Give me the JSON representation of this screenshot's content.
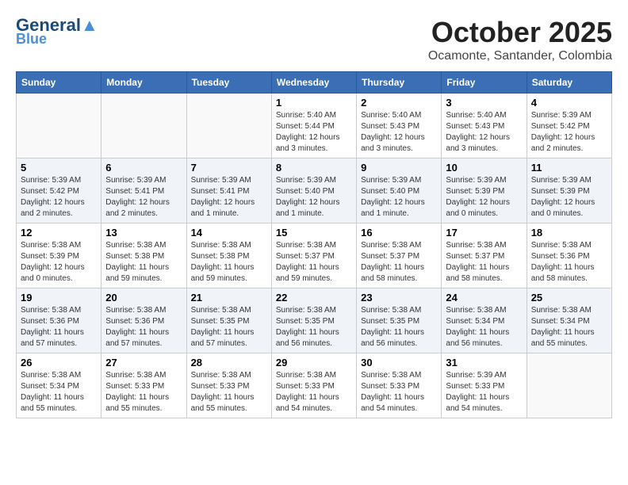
{
  "header": {
    "logo_line1": "General",
    "logo_line2": "Blue",
    "month": "October 2025",
    "location": "Ocamonte, Santander, Colombia"
  },
  "weekdays": [
    "Sunday",
    "Monday",
    "Tuesday",
    "Wednesday",
    "Thursday",
    "Friday",
    "Saturday"
  ],
  "weeks": [
    [
      {
        "day": "",
        "info": ""
      },
      {
        "day": "",
        "info": ""
      },
      {
        "day": "",
        "info": ""
      },
      {
        "day": "1",
        "info": "Sunrise: 5:40 AM\nSunset: 5:44 PM\nDaylight: 12 hours\nand 3 minutes."
      },
      {
        "day": "2",
        "info": "Sunrise: 5:40 AM\nSunset: 5:43 PM\nDaylight: 12 hours\nand 3 minutes."
      },
      {
        "day": "3",
        "info": "Sunrise: 5:40 AM\nSunset: 5:43 PM\nDaylight: 12 hours\nand 3 minutes."
      },
      {
        "day": "4",
        "info": "Sunrise: 5:39 AM\nSunset: 5:42 PM\nDaylight: 12 hours\nand 2 minutes."
      }
    ],
    [
      {
        "day": "5",
        "info": "Sunrise: 5:39 AM\nSunset: 5:42 PM\nDaylight: 12 hours\nand 2 minutes."
      },
      {
        "day": "6",
        "info": "Sunrise: 5:39 AM\nSunset: 5:41 PM\nDaylight: 12 hours\nand 2 minutes."
      },
      {
        "day": "7",
        "info": "Sunrise: 5:39 AM\nSunset: 5:41 PM\nDaylight: 12 hours\nand 1 minute."
      },
      {
        "day": "8",
        "info": "Sunrise: 5:39 AM\nSunset: 5:40 PM\nDaylight: 12 hours\nand 1 minute."
      },
      {
        "day": "9",
        "info": "Sunrise: 5:39 AM\nSunset: 5:40 PM\nDaylight: 12 hours\nand 1 minute."
      },
      {
        "day": "10",
        "info": "Sunrise: 5:39 AM\nSunset: 5:39 PM\nDaylight: 12 hours\nand 0 minutes."
      },
      {
        "day": "11",
        "info": "Sunrise: 5:39 AM\nSunset: 5:39 PM\nDaylight: 12 hours\nand 0 minutes."
      }
    ],
    [
      {
        "day": "12",
        "info": "Sunrise: 5:38 AM\nSunset: 5:39 PM\nDaylight: 12 hours\nand 0 minutes."
      },
      {
        "day": "13",
        "info": "Sunrise: 5:38 AM\nSunset: 5:38 PM\nDaylight: 11 hours\nand 59 minutes."
      },
      {
        "day": "14",
        "info": "Sunrise: 5:38 AM\nSunset: 5:38 PM\nDaylight: 11 hours\nand 59 minutes."
      },
      {
        "day": "15",
        "info": "Sunrise: 5:38 AM\nSunset: 5:37 PM\nDaylight: 11 hours\nand 59 minutes."
      },
      {
        "day": "16",
        "info": "Sunrise: 5:38 AM\nSunset: 5:37 PM\nDaylight: 11 hours\nand 58 minutes."
      },
      {
        "day": "17",
        "info": "Sunrise: 5:38 AM\nSunset: 5:37 PM\nDaylight: 11 hours\nand 58 minutes."
      },
      {
        "day": "18",
        "info": "Sunrise: 5:38 AM\nSunset: 5:36 PM\nDaylight: 11 hours\nand 58 minutes."
      }
    ],
    [
      {
        "day": "19",
        "info": "Sunrise: 5:38 AM\nSunset: 5:36 PM\nDaylight: 11 hours\nand 57 minutes."
      },
      {
        "day": "20",
        "info": "Sunrise: 5:38 AM\nSunset: 5:36 PM\nDaylight: 11 hours\nand 57 minutes."
      },
      {
        "day": "21",
        "info": "Sunrise: 5:38 AM\nSunset: 5:35 PM\nDaylight: 11 hours\nand 57 minutes."
      },
      {
        "day": "22",
        "info": "Sunrise: 5:38 AM\nSunset: 5:35 PM\nDaylight: 11 hours\nand 56 minutes."
      },
      {
        "day": "23",
        "info": "Sunrise: 5:38 AM\nSunset: 5:35 PM\nDaylight: 11 hours\nand 56 minutes."
      },
      {
        "day": "24",
        "info": "Sunrise: 5:38 AM\nSunset: 5:34 PM\nDaylight: 11 hours\nand 56 minutes."
      },
      {
        "day": "25",
        "info": "Sunrise: 5:38 AM\nSunset: 5:34 PM\nDaylight: 11 hours\nand 55 minutes."
      }
    ],
    [
      {
        "day": "26",
        "info": "Sunrise: 5:38 AM\nSunset: 5:34 PM\nDaylight: 11 hours\nand 55 minutes."
      },
      {
        "day": "27",
        "info": "Sunrise: 5:38 AM\nSunset: 5:33 PM\nDaylight: 11 hours\nand 55 minutes."
      },
      {
        "day": "28",
        "info": "Sunrise: 5:38 AM\nSunset: 5:33 PM\nDaylight: 11 hours\nand 55 minutes."
      },
      {
        "day": "29",
        "info": "Sunrise: 5:38 AM\nSunset: 5:33 PM\nDaylight: 11 hours\nand 54 minutes."
      },
      {
        "day": "30",
        "info": "Sunrise: 5:38 AM\nSunset: 5:33 PM\nDaylight: 11 hours\nand 54 minutes."
      },
      {
        "day": "31",
        "info": "Sunrise: 5:39 AM\nSunset: 5:33 PM\nDaylight: 11 hours\nand 54 minutes."
      },
      {
        "day": "",
        "info": ""
      }
    ]
  ]
}
